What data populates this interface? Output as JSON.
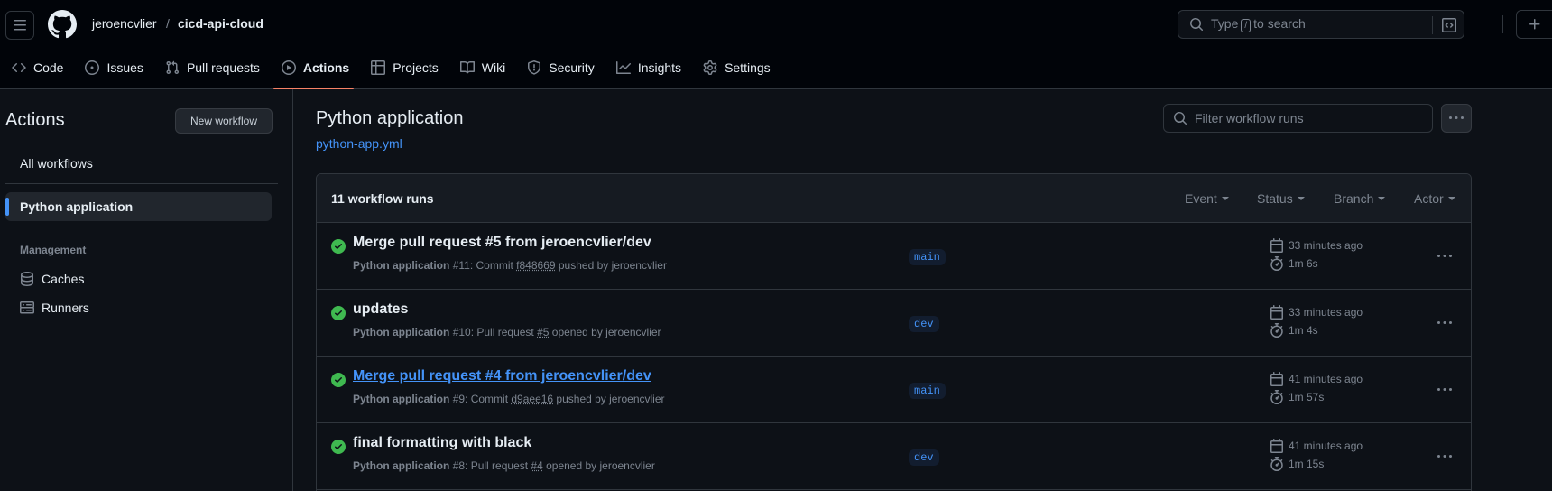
{
  "header": {
    "owner": "jeroencvlier",
    "separator": "/",
    "repo": "cicd-api-cloud",
    "search_type": "Type",
    "search_key": "/",
    "search_rest": "to search"
  },
  "nav": [
    {
      "label": "Code",
      "icon": "code-icon"
    },
    {
      "label": "Issues",
      "icon": "issue-opened-icon"
    },
    {
      "label": "Pull requests",
      "icon": "git-pull-request-icon"
    },
    {
      "label": "Actions",
      "icon": "play-icon",
      "active": true
    },
    {
      "label": "Projects",
      "icon": "table-icon"
    },
    {
      "label": "Wiki",
      "icon": "book-icon"
    },
    {
      "label": "Security",
      "icon": "shield-icon"
    },
    {
      "label": "Insights",
      "icon": "graph-icon"
    },
    {
      "label": "Settings",
      "icon": "gear-icon"
    }
  ],
  "sidebar": {
    "title": "Actions",
    "new_workflow": "New workflow",
    "all_workflows": "All workflows",
    "selected_workflow": "Python application",
    "management_heading": "Management",
    "caches": "Caches",
    "runners": "Runners"
  },
  "main": {
    "workflow_title": "Python application",
    "workflow_file": "python-app.yml",
    "filter_placeholder": "Filter workflow runs",
    "runs_count": "11 workflow runs",
    "filters": [
      "Event",
      "Status",
      "Branch",
      "Actor"
    ]
  },
  "runs": [
    {
      "title": "Merge pull request #5 from jeroencvlier/dev",
      "workflow": "Python application",
      "meta_pre": "#11: Commit ",
      "meta_ref": "f848669",
      "meta_post": " pushed by jeroencvlier",
      "branch": "main",
      "when": "33 minutes ago",
      "duration": "1m 6s",
      "status": "success",
      "link": false
    },
    {
      "title": "updates",
      "workflow": "Python application",
      "meta_pre": "#10: Pull request ",
      "meta_ref": "#5",
      "meta_post": " opened by jeroencvlier",
      "branch": "dev",
      "when": "33 minutes ago",
      "duration": "1m 4s",
      "status": "success",
      "link": false
    },
    {
      "title": "Merge pull request #4 from jeroencvlier/dev",
      "workflow": "Python application",
      "meta_pre": "#9: Commit ",
      "meta_ref": "d9aee16",
      "meta_post": " pushed by jeroencvlier",
      "branch": "main",
      "when": "41 minutes ago",
      "duration": "1m 57s",
      "status": "success",
      "link": true
    },
    {
      "title": "final formatting with black",
      "workflow": "Python application",
      "meta_pre": "#8: Pull request ",
      "meta_ref": "#4",
      "meta_post": " opened by jeroencvlier",
      "branch": "dev",
      "when": "41 minutes ago",
      "duration": "1m 15s",
      "status": "success",
      "link": false
    }
  ],
  "colors": {
    "accent": "#4493f8",
    "success": "#3fb950",
    "active_underline": "#f78166",
    "bg": "#0d1117"
  }
}
